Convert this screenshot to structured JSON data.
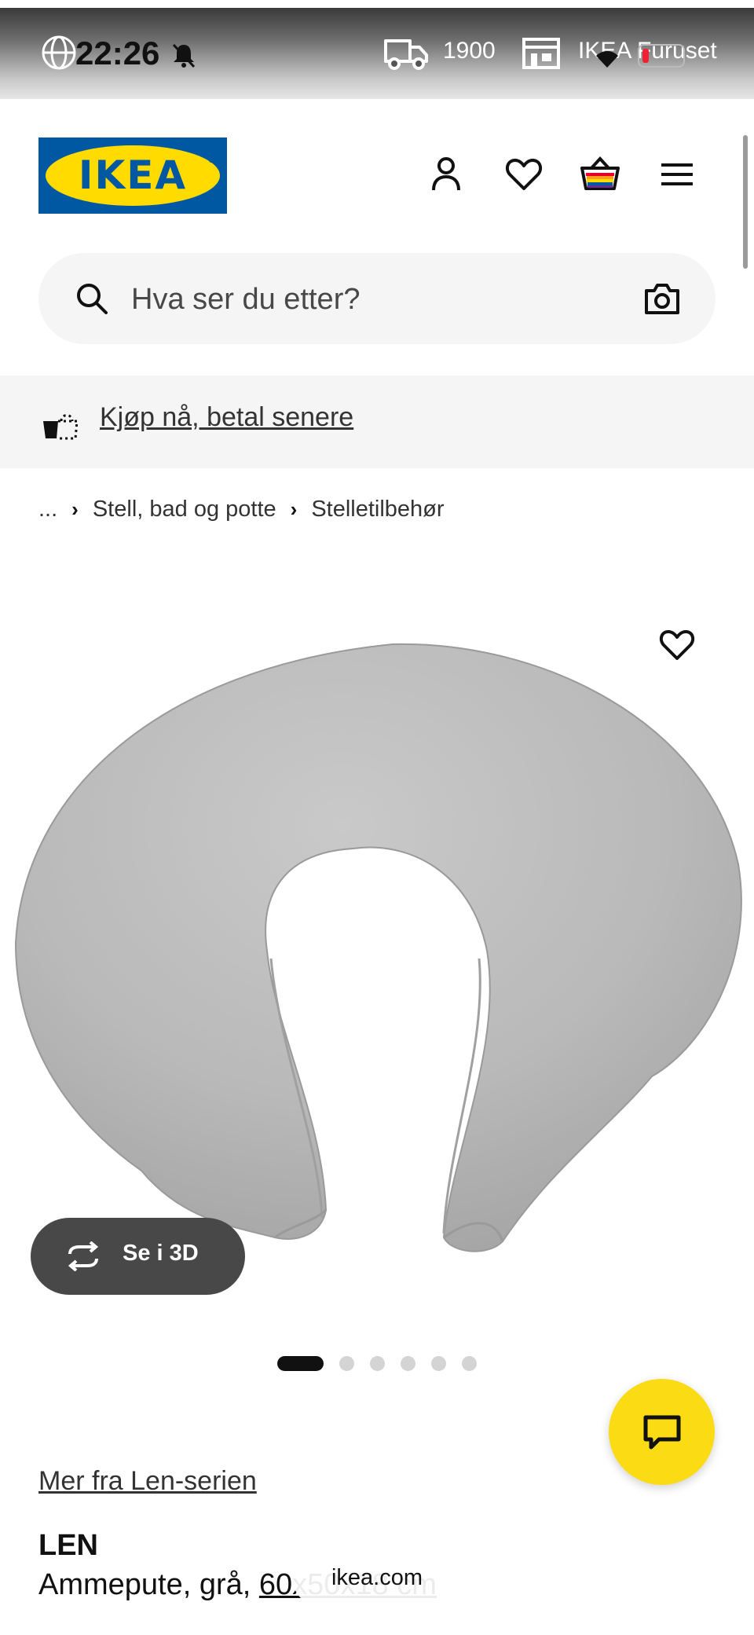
{
  "status_bar": {
    "time": "22:26",
    "phone_number": "1900",
    "store_name": "IKEA Furuset"
  },
  "header": {
    "logo_text": "IKEA",
    "logo_reg": "®"
  },
  "search": {
    "placeholder": "Hva ser du etter?"
  },
  "promo": {
    "text": "Kjøp nå, betal senere"
  },
  "breadcrumb": {
    "ellipsis": "...",
    "items": [
      "Stell, bad og potte",
      "Stelletilbehør"
    ]
  },
  "product": {
    "view_3d_label": "Se i 3D",
    "image_count": 6,
    "active_image_index": 0,
    "series_link": "Mer fra Len-serien",
    "name": "LEN",
    "description_prefix": "Ammepute, grå, ",
    "description_dims": "60x50x18 cm"
  },
  "browser": {
    "url": "ikea.com"
  },
  "colors": {
    "ikea_blue": "#0058a3",
    "ikea_yellow": "#ffdb00",
    "chat_yellow": "#fadb14",
    "pill_dark": "#484848"
  },
  "icons": {
    "globe": "globe-icon",
    "bell": "bell-muted-icon",
    "truck": "delivery-truck-icon",
    "store": "store-icon",
    "wifi": "wifi-icon",
    "battery": "battery-icon",
    "account": "person-icon",
    "favorites": "heart-icon",
    "cart": "shopping-bag-icon",
    "menu": "hamburger-menu-icon",
    "search": "search-icon",
    "camera": "camera-icon",
    "promo": "pay-later-icon",
    "rotate": "rotate-3d-icon",
    "chat": "chat-bubble-icon"
  }
}
